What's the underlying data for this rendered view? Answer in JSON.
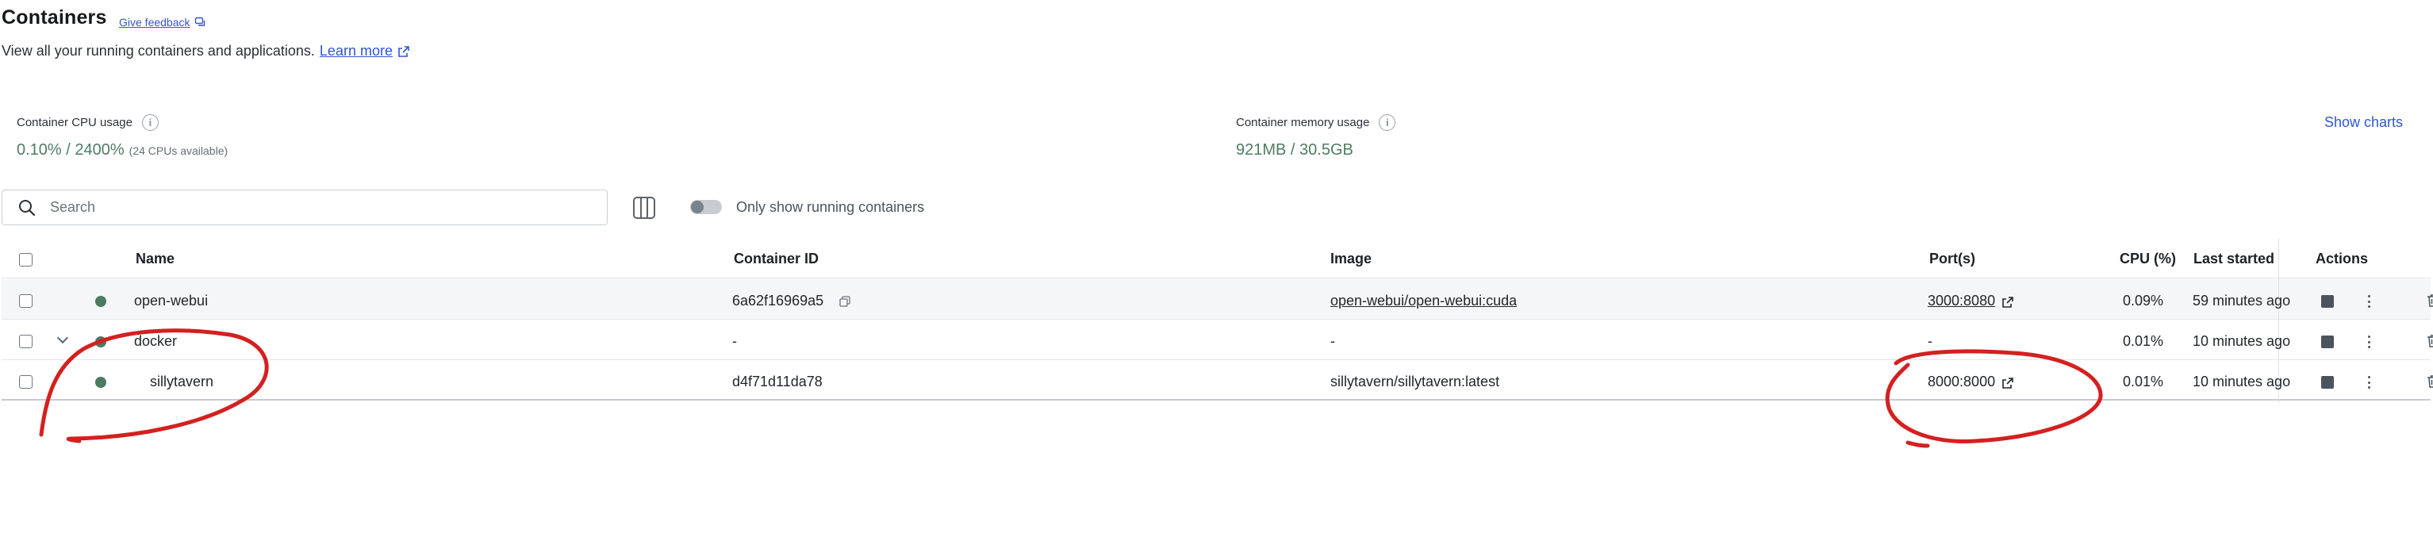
{
  "header": {
    "title": "Containers",
    "feedback_label": "Give feedback",
    "subtitle": "View all your running containers and applications.",
    "learn_more": "Learn more"
  },
  "stats": {
    "cpu_label": "Container CPU usage",
    "cpu_value": "0.10% / 2400%",
    "cpu_sub": "(24 CPUs available)",
    "mem_label": "Container memory usage",
    "mem_value": "921MB / 30.5GB",
    "show_charts": "Show charts"
  },
  "toolbar": {
    "search_placeholder": "Search",
    "running_toggle_label": "Only show running containers",
    "running_toggle_on": false
  },
  "table": {
    "columns": {
      "name": "Name",
      "container_id": "Container ID",
      "image": "Image",
      "ports": "Port(s)",
      "cpu": "CPU (%)",
      "last_started": "Last started",
      "actions": "Actions"
    },
    "rows": [
      {
        "name": "open-webui",
        "container_id": "6a62f16969a5",
        "image": "open-webui/open-webui:cuda",
        "ports": "3000:8080",
        "cpu": "0.09%",
        "last_started": "59 minutes ago"
      },
      {
        "name": "docker",
        "container_id": "-",
        "image": "-",
        "ports": "-",
        "cpu": "0.01%",
        "last_started": "10 minutes ago"
      },
      {
        "name": "sillytavern",
        "container_id": "d4f71d11da78",
        "image": "sillytavern/sillytavern:latest",
        "ports": "8000:8000",
        "cpu": "0.01%",
        "last_started": "10 minutes ago"
      }
    ]
  },
  "colors": {
    "accent": "#2f56d1",
    "status_running": "#4c7a62",
    "stat_value": "#4f7d63",
    "annotation_red": "#d42020"
  },
  "icons": [
    "feedback-icon",
    "external-link-icon",
    "info-icon",
    "search-icon",
    "columns-icon",
    "copy-icon",
    "chevron-down-icon",
    "stop-icon",
    "more-icon",
    "trash-icon"
  ]
}
